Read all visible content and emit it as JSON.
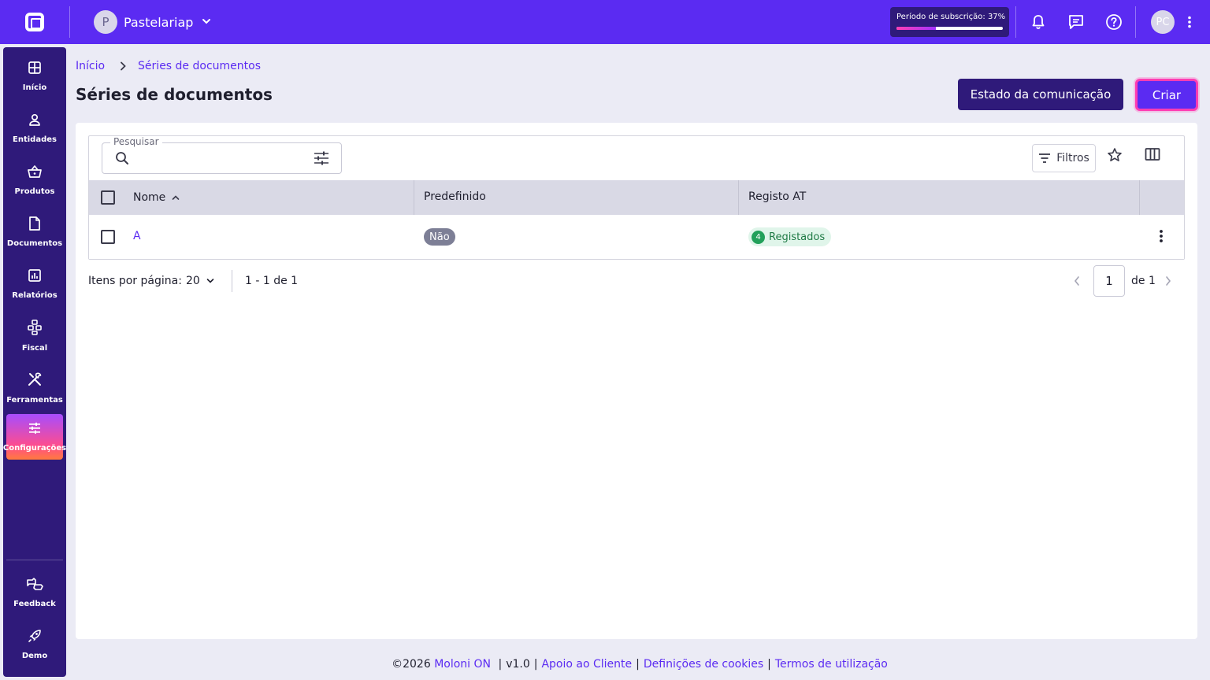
{
  "company": {
    "initial": "P",
    "name": "Pastelariap"
  },
  "subscription": {
    "label": "Período de subscrição: 37%",
    "progress_percent": 37
  },
  "user": {
    "initials": "PC"
  },
  "sidebar": {
    "items": [
      {
        "label": "Início",
        "icon": "home-grid-icon"
      },
      {
        "label": "Entidades",
        "icon": "person-icon"
      },
      {
        "label": "Produtos",
        "icon": "basket-icon"
      },
      {
        "label": "Documentos",
        "icon": "document-icon"
      },
      {
        "label": "Relatórios",
        "icon": "report-chart-icon"
      },
      {
        "label": "Fiscal",
        "icon": "fiscal-hierarchy-icon"
      },
      {
        "label": "Ferramentas",
        "icon": "tools-icon"
      },
      {
        "label": "Configurações",
        "icon": "settings-sliders-icon",
        "active": true
      }
    ],
    "bottom_items": [
      {
        "label": "Feedback",
        "icon": "feedback-icon"
      },
      {
        "label": "Demo",
        "icon": "rocket-icon"
      }
    ]
  },
  "breadcrumb": {
    "home": "Início",
    "current": "Séries de documentos"
  },
  "page": {
    "title": "Séries de documentos"
  },
  "buttons": {
    "estado": "Estado da comunicação",
    "criar": "Criar"
  },
  "search": {
    "label": "Pesquisar",
    "value": ""
  },
  "toolbar": {
    "filters_label": "Filtros"
  },
  "table": {
    "columns": [
      "Nome",
      "Predefinido",
      "Registo AT"
    ],
    "sort_column": "Nome",
    "sort_direction": "ascending",
    "rows": [
      {
        "nome": "A",
        "predefinido": "Não",
        "registo_count": "4",
        "registo_label": "Registados"
      }
    ]
  },
  "pagination": {
    "per_page_label": "Itens por página:",
    "per_page_value": "20",
    "range": "1 - 1 de 1",
    "current_page": "1",
    "of_label": "de 1"
  },
  "footer": {
    "copyright": "©2026",
    "brand": "Moloni ON",
    "version": "v1.0",
    "links": [
      "Apoio ao Cliente",
      "Definições de cookies",
      "Termos de utilização"
    ]
  },
  "colors": {
    "brand": "#5b2bf2",
    "sidebar": "#2f1a7a",
    "accent_pink": "#ff3db3",
    "success": "#22a05a"
  }
}
